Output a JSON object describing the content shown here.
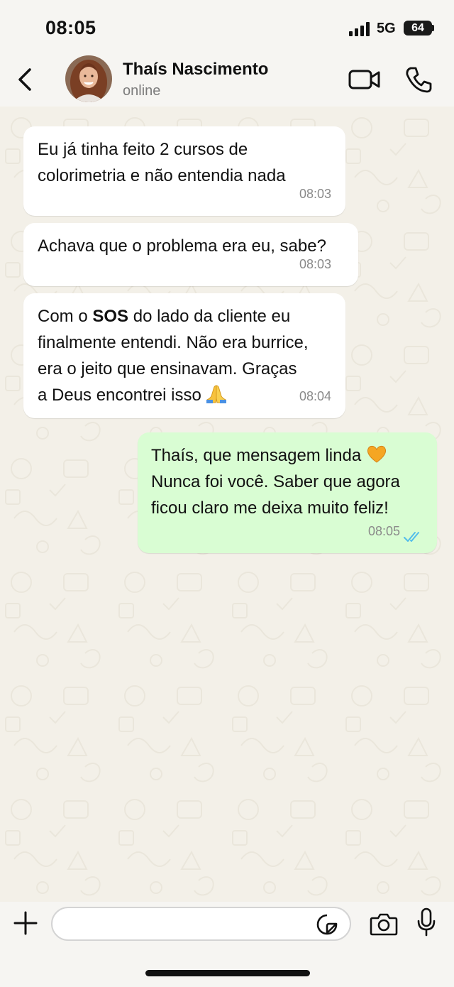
{
  "status_bar": {
    "time": "08:05",
    "network": "5G",
    "battery": "64"
  },
  "header": {
    "contact_name": "Thaís Nascimento",
    "contact_status": "online"
  },
  "messages": [
    {
      "direction": "incoming",
      "lines": [
        "Eu já tinha feito 2 cursos de",
        "colorimetria e não entendia nada"
      ],
      "time": "08:03"
    },
    {
      "direction": "incoming",
      "lines": [
        "Achava que o problema era eu, sabe?"
      ],
      "time": "08:03"
    },
    {
      "direction": "incoming",
      "line1_pre": "Com o ",
      "line1_bold": "SOS",
      "line1_post": " do lado da cliente eu",
      "line2": "finalmente entendi. Não era burrice,",
      "line3": "era o jeito que ensinavam. Graças",
      "line4": "a Deus encontrei isso",
      "emoji": "folded-hands",
      "time": "08:04"
    },
    {
      "direction": "outgoing",
      "line1": "Thaís, que mensagem linda",
      "emoji": "orange-heart",
      "line2": "Nunca foi você. Saber que agora",
      "line3": "ficou claro me deixa muito feliz!",
      "time": "08:05",
      "status": "read"
    }
  ],
  "composer": {
    "value": "",
    "placeholder": ""
  },
  "icons": {
    "back": "chevron-left-icon",
    "video": "video-camera-icon",
    "call": "phone-icon",
    "add": "plus-icon",
    "sticker": "sticker-icon",
    "camera": "camera-icon",
    "mic": "microphone-icon"
  },
  "colors": {
    "incoming_bubble": "#ffffff",
    "outgoing_bubble": "#d9fdd3",
    "read_ticks": "#53bdeb",
    "background": "#f3f0e8"
  }
}
